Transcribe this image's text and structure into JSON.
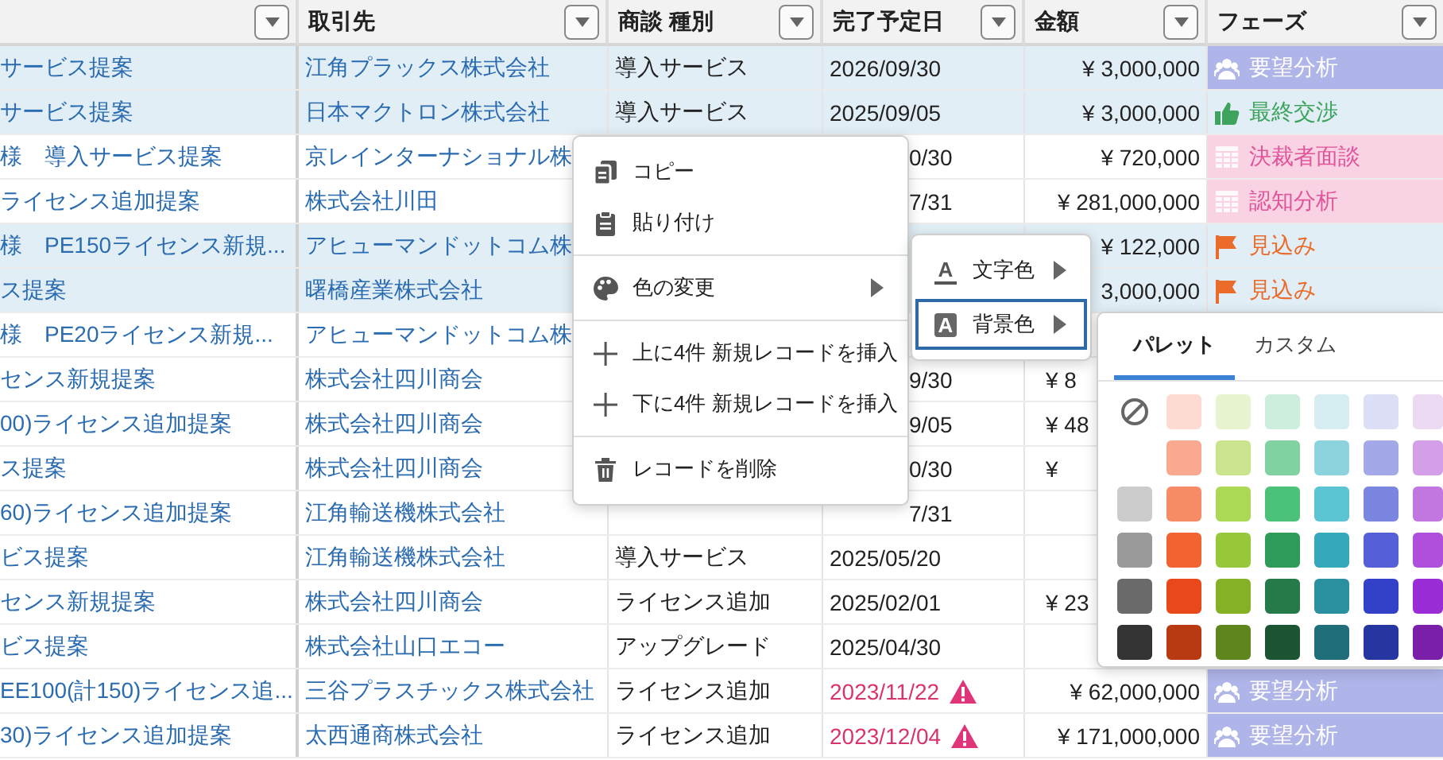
{
  "table": {
    "columns": [
      {},
      {
        "title": "取引先"
      },
      {
        "title": "商談 種別"
      },
      {
        "title": "完了予定日"
      },
      {
        "title": "金額"
      },
      {
        "title": "フェーズ"
      }
    ],
    "rows": [
      {
        "selected": true,
        "title": "サービス提案",
        "account": "江角プラックス株式会社",
        "type": "導入サービス",
        "date": "2026/09/30",
        "overdue": false,
        "amount": "¥ 3,000,000",
        "phase": {
          "label": "要望分析",
          "kind": "analysis"
        }
      },
      {
        "selected": true,
        "title": "サービス提案",
        "account": "日本マクトロン株式会社",
        "type": "導入サービス",
        "date": "2025/09/05",
        "overdue": false,
        "amount": "¥ 3,000,000",
        "phase": {
          "label": "最終交渉",
          "kind": "negotiation"
        }
      },
      {
        "selected": false,
        "title": "様　導入サービス提案",
        "account": "京レインターナショナル株",
        "date_fragment": "0/30",
        "amount": "¥ 720,000",
        "phase": {
          "label": "決裁者面談",
          "kind": "decision"
        }
      },
      {
        "selected": false,
        "title": "ライセンス追加提案",
        "account": "株式会社川田",
        "date_fragment": "7/31",
        "amount": "¥ 281,000,000",
        "phase": {
          "label": "認知分析",
          "kind": "awareness"
        }
      },
      {
        "selected": true,
        "title": "様　PE150ライセンス新規...",
        "account": "アヒューマンドットコム株",
        "amount": "¥ 122,000",
        "phase": {
          "label": "見込み",
          "kind": "prospect"
        }
      },
      {
        "selected": true,
        "title": "ス提案",
        "account": "曙橋産業株式会社",
        "amount": "3,000,000",
        "phase": {
          "label": "見込み",
          "kind": "prospect"
        }
      },
      {
        "selected": false,
        "title": "様　PE20ライセンス新規...",
        "account": "アヒューマンドットコム株"
      },
      {
        "selected": false,
        "title": "センス新規提案",
        "account": "株式会社四川商会",
        "date_fragment": "9/30",
        "amount_fragment": "¥ 8"
      },
      {
        "selected": false,
        "title": "00)ライセンス追加提案",
        "account": "株式会社四川商会",
        "date_fragment": "9/05",
        "amount_fragment": "¥ 48"
      },
      {
        "selected": false,
        "title": "ス提案",
        "account": "株式会社四川商会",
        "date_fragment": "0/30",
        "amount_fragment": "¥"
      },
      {
        "selected": false,
        "title": "60)ライセンス追加提案",
        "account": "江角輸送機株式会社",
        "date_fragment": "7/31"
      },
      {
        "selected": false,
        "title": "ビス提案",
        "account": "江角輸送機株式会社",
        "type": "導入サービス",
        "date": "2025/05/20",
        "overdue": false
      },
      {
        "selected": false,
        "title": "センス新規提案",
        "account": "株式会社四川商会",
        "type": "ライセンス追加",
        "date": "2025/02/01",
        "overdue": false,
        "amount_fragment": "¥ 23"
      },
      {
        "selected": false,
        "title": "ビス提案",
        "account": "株式会社山口エコー",
        "type": "アップグレード",
        "date": "2025/04/30",
        "overdue": false
      },
      {
        "selected": false,
        "title": "EE100(計150)ライセンス追...",
        "account": "三谷プラスチックス株式会社",
        "type": "ライセンス追加",
        "date": "2023/11/22",
        "overdue": true,
        "amount": "¥ 62,000,000",
        "phase": {
          "label": "要望分析",
          "kind": "analysis"
        }
      },
      {
        "selected": false,
        "title": "30)ライセンス追加提案",
        "account": "太西通商株式会社",
        "type": "ライセンス追加",
        "date": "2023/12/04",
        "overdue": true,
        "amount": "¥ 171,000,000",
        "phase": {
          "label": "要望分析",
          "kind": "analysis"
        }
      }
    ]
  },
  "context_menu": {
    "groups": [
      [
        {
          "label": "コピー",
          "kind": "copy"
        },
        {
          "label": "貼り付け",
          "kind": "paste"
        }
      ],
      [
        {
          "label": "色の変更",
          "kind": "color",
          "has_submenu": true
        }
      ],
      [
        {
          "label": "上に4件 新規レコードを挿入",
          "kind": "insert"
        },
        {
          "label": "下に4件 新規レコードを挿入",
          "kind": "insert"
        }
      ],
      [
        {
          "label": "レコードを削除",
          "kind": "delete"
        }
      ]
    ]
  },
  "color_submenu": {
    "items": [
      {
        "label": "文字色",
        "glyph": "A",
        "kind": "text-color",
        "selected": false,
        "has_submenu": true
      },
      {
        "label": "背景色",
        "glyph": "A",
        "kind": "fill-color",
        "selected": true,
        "has_submenu": true
      }
    ]
  },
  "palette": {
    "tabs": [
      {
        "label": "パレット",
        "selected": true
      },
      {
        "label": "カスタム",
        "selected": false
      }
    ],
    "swatch_rows": [
      {
        "kind": "clear",
        "swatches": [
          {
            "color": "#fddbd3"
          },
          {
            "color": "#e8f4cf"
          },
          {
            "color": "#cdeedd"
          },
          {
            "color": "#d6eef2"
          },
          {
            "color": "#dcdff5"
          },
          {
            "color": "#ecdaf2"
          }
        ]
      },
      {
        "kind": "plain",
        "swatches": [
          {
            "color": "#f8a98f"
          },
          {
            "color": "#c9e48c"
          },
          {
            "color": "#80d3a0"
          },
          {
            "color": "#8dd3dd"
          },
          {
            "color": "#a3a9e8"
          },
          {
            "color": "#d39fe6"
          }
        ]
      },
      {
        "kind": "gray",
        "swatches": [
          {
            "color": "#cccccc"
          },
          {
            "color": "#f68b65"
          },
          {
            "color": "#acd955"
          },
          {
            "color": "#4cc17a"
          },
          {
            "color": "#5cc3d2"
          },
          {
            "color": "#7a86df"
          },
          {
            "color": "#c276e0"
          }
        ]
      },
      {
        "kind": "gray",
        "swatches": [
          {
            "color": "#9a9a9a"
          },
          {
            "color": "#f16331"
          },
          {
            "color": "#96c83a"
          },
          {
            "color": "#2e9b5b"
          },
          {
            "color": "#36a8bb"
          },
          {
            "color": "#5560d8"
          },
          {
            "color": "#b04fdb"
          }
        ]
      },
      {
        "kind": "gray",
        "swatches": [
          {
            "color": "#6a6a6a"
          },
          {
            "color": "#e8481a"
          },
          {
            "color": "#85b127"
          },
          {
            "color": "#247a48"
          },
          {
            "color": "#2a8f9f"
          },
          {
            "color": "#3341c8"
          },
          {
            "color": "#9a2dd6"
          }
        ]
      },
      {
        "kind": "gray",
        "swatches": [
          {
            "color": "#343434"
          },
          {
            "color": "#b83a12"
          },
          {
            "color": "#5e851e"
          },
          {
            "color": "#1d5534"
          },
          {
            "color": "#1f6e7a"
          },
          {
            "color": "#2536a0"
          },
          {
            "color": "#7a1fa8"
          }
        ]
      }
    ]
  }
}
